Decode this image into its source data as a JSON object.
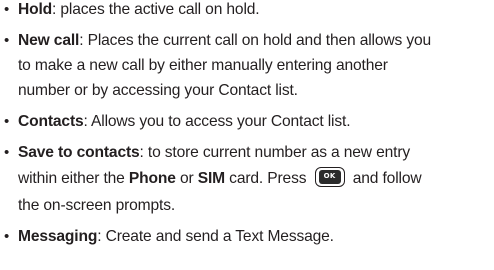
{
  "bullet_char": "•",
  "items": [
    {
      "term": "Hold",
      "line1": ": places the active call on hold."
    },
    {
      "term": "New call",
      "line1": ": Places the current call on hold and then allows you",
      "line2": "to make a new call by either manually entering another",
      "line3": "number or by accessing your Contact list."
    },
    {
      "term": "Contacts",
      "line1": ": Allows you to access your Contact list."
    },
    {
      "term": "Save to contacts",
      "line1": ": to store current number as a new entry",
      "line2_a": "within either the ",
      "line2_b": "Phone",
      "line2_c": " or ",
      "line2_d": "SIM",
      "line2_e": " card. Press ",
      "ok_label": "OK",
      "line2_f": " and follow",
      "line3": "the on-screen prompts."
    },
    {
      "term": "Messaging",
      "line1": ": Create and send a Text Message."
    }
  ],
  "ok_icon": "ok-key-icon"
}
